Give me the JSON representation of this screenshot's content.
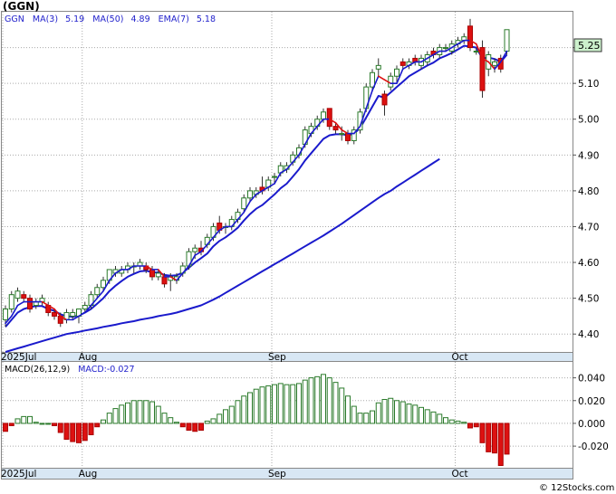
{
  "chart_data": {
    "type": "candlestick",
    "symbol": "(GGN)",
    "legend": {
      "symbol": "GGN",
      "ma3_label": "MA(3)",
      "ma3_value": "5.19",
      "ma50_label": "MA(50)",
      "ma50_value": "4.89",
      "ema7_label": "EMA(7)",
      "ema7_value": "5.18"
    },
    "last_price_label": "5.25",
    "y_ticks": [
      "5.20",
      "5.10",
      "5.00",
      "4.90",
      "4.80",
      "4.70",
      "4.60",
      "4.50",
      "4.40"
    ],
    "y_tick_values": [
      5.2,
      5.1,
      5.0,
      4.9,
      4.8,
      4.7,
      4.6,
      4.5,
      4.4
    ],
    "ylim": [
      4.35,
      5.3
    ],
    "x_labels": [
      "2025Jul",
      "Aug",
      "Sep",
      "Oct"
    ],
    "x_label_index": [
      0,
      13,
      44,
      74
    ],
    "ohlc": [
      [
        4.44,
        4.48,
        4.42,
        4.47
      ],
      [
        4.47,
        4.52,
        4.46,
        4.51
      ],
      [
        4.5,
        4.53,
        4.49,
        4.52
      ],
      [
        4.51,
        4.52,
        4.49,
        4.5
      ],
      [
        4.5,
        4.51,
        4.46,
        4.47
      ],
      [
        4.48,
        4.5,
        4.47,
        4.49
      ],
      [
        4.49,
        4.51,
        4.48,
        4.5
      ],
      [
        4.48,
        4.49,
        4.45,
        4.46
      ],
      [
        4.46,
        4.47,
        4.44,
        4.45
      ],
      [
        4.45,
        4.46,
        4.42,
        4.43
      ],
      [
        4.44,
        4.47,
        4.43,
        4.46
      ],
      [
        4.45,
        4.47,
        4.44,
        4.46
      ],
      [
        4.45,
        4.47,
        4.43,
        4.47
      ],
      [
        4.47,
        4.49,
        4.46,
        4.48
      ],
      [
        4.48,
        4.52,
        4.47,
        4.51
      ],
      [
        4.51,
        4.54,
        4.5,
        4.53
      ],
      [
        4.53,
        4.56,
        4.52,
        4.55
      ],
      [
        4.55,
        4.58,
        4.54,
        4.58
      ],
      [
        4.57,
        4.59,
        4.56,
        4.58
      ],
      [
        4.57,
        4.59,
        4.56,
        4.58
      ],
      [
        4.58,
        4.6,
        4.57,
        4.59
      ],
      [
        4.59,
        4.6,
        4.57,
        4.59
      ],
      [
        4.59,
        4.61,
        4.58,
        4.6
      ],
      [
        4.59,
        4.6,
        4.57,
        4.58
      ],
      [
        4.58,
        4.59,
        4.55,
        4.56
      ],
      [
        4.56,
        4.58,
        4.55,
        4.57
      ],
      [
        4.56,
        4.57,
        4.53,
        4.54
      ],
      [
        4.55,
        4.57,
        4.52,
        4.56
      ],
      [
        4.55,
        4.57,
        4.54,
        4.56
      ],
      [
        4.57,
        4.6,
        4.56,
        4.59
      ],
      [
        4.59,
        4.64,
        4.58,
        4.63
      ],
      [
        4.63,
        4.65,
        4.61,
        4.64
      ],
      [
        4.64,
        4.66,
        4.62,
        4.63
      ],
      [
        4.65,
        4.68,
        4.64,
        4.67
      ],
      [
        4.67,
        4.71,
        4.66,
        4.7
      ],
      [
        4.71,
        4.73,
        4.68,
        4.69
      ],
      [
        4.7,
        4.71,
        4.68,
        4.7
      ],
      [
        4.7,
        4.73,
        4.69,
        4.72
      ],
      [
        4.72,
        4.75,
        4.71,
        4.74
      ],
      [
        4.75,
        4.79,
        4.74,
        4.78
      ],
      [
        4.78,
        4.81,
        4.77,
        4.8
      ],
      [
        4.79,
        4.81,
        4.78,
        4.8
      ],
      [
        4.81,
        4.84,
        4.79,
        4.8
      ],
      [
        4.81,
        4.84,
        4.8,
        4.83
      ],
      [
        4.84,
        4.85,
        4.82,
        4.84
      ],
      [
        4.85,
        4.88,
        4.84,
        4.87
      ],
      [
        4.86,
        4.88,
        4.85,
        4.87
      ],
      [
        4.88,
        4.91,
        4.87,
        4.9
      ],
      [
        4.9,
        4.93,
        4.89,
        4.92
      ],
      [
        4.93,
        4.98,
        4.92,
        4.97
      ],
      [
        4.96,
        4.99,
        4.95,
        4.98
      ],
      [
        4.98,
        5.01,
        4.97,
        5.0
      ],
      [
        5.0,
        5.03,
        4.99,
        5.02
      ],
      [
        5.03,
        5.03,
        4.97,
        4.98
      ],
      [
        4.98,
        4.99,
        4.96,
        4.97
      ],
      [
        4.96,
        4.98,
        4.94,
        4.96
      ],
      [
        4.96,
        4.97,
        4.93,
        4.94
      ],
      [
        4.94,
        4.98,
        4.93,
        4.97
      ],
      [
        4.97,
        5.03,
        4.96,
        5.02
      ],
      [
        5.03,
        5.1,
        5.02,
        5.09
      ],
      [
        5.09,
        5.14,
        5.08,
        5.13
      ],
      [
        5.14,
        5.17,
        5.12,
        5.15
      ],
      [
        5.07,
        5.08,
        5.01,
        5.04
      ],
      [
        5.09,
        5.13,
        5.08,
        5.12
      ],
      [
        5.12,
        5.15,
        5.1,
        5.14
      ],
      [
        5.16,
        5.17,
        5.14,
        5.15
      ],
      [
        5.15,
        5.17,
        5.14,
        5.16
      ],
      [
        5.17,
        5.18,
        5.15,
        5.16
      ],
      [
        5.15,
        5.18,
        5.14,
        5.17
      ],
      [
        5.16,
        5.19,
        5.15,
        5.18
      ],
      [
        5.19,
        5.2,
        5.17,
        5.18
      ],
      [
        5.18,
        5.21,
        5.17,
        5.2
      ],
      [
        5.2,
        5.21,
        5.19,
        5.2
      ],
      [
        5.19,
        5.22,
        5.18,
        5.21
      ],
      [
        5.21,
        5.23,
        5.2,
        5.22
      ],
      [
        5.22,
        5.24,
        5.21,
        5.23
      ],
      [
        5.26,
        5.28,
        5.19,
        5.2
      ],
      [
        5.19,
        5.2,
        5.18,
        5.19
      ],
      [
        5.2,
        5.22,
        5.06,
        5.08
      ],
      [
        5.14,
        5.19,
        5.12,
        5.18
      ],
      [
        5.15,
        5.17,
        5.13,
        5.16
      ],
      [
        5.17,
        5.18,
        5.13,
        5.14
      ],
      [
        5.19,
        5.25,
        5.18,
        5.25
      ]
    ],
    "ma3": [
      4.43,
      4.45,
      4.48,
      4.49,
      4.49,
      4.49,
      4.49,
      4.48,
      4.47,
      4.45,
      4.44,
      4.44,
      4.45,
      4.46,
      4.48,
      4.5,
      4.52,
      4.55,
      4.57,
      4.58,
      4.58,
      4.59,
      4.59,
      4.59,
      4.58,
      4.58,
      4.56,
      4.56,
      4.55,
      4.57,
      4.59,
      4.62,
      4.63,
      4.65,
      4.67,
      4.69,
      4.7,
      4.7,
      4.72,
      4.74,
      4.77,
      4.79,
      4.8,
      4.81,
      4.82,
      4.85,
      4.86,
      4.88,
      4.9,
      4.93,
      4.96,
      4.98,
      5.0,
      5.0,
      4.99,
      4.97,
      4.96,
      4.96,
      4.98,
      5.03,
      5.08,
      5.12,
      5.11,
      5.1,
      5.1,
      5.14,
      5.15,
      5.16,
      5.16,
      5.17,
      5.18,
      5.19,
      5.19,
      5.2,
      5.21,
      5.22,
      5.22,
      5.21,
      5.17,
      5.16,
      5.14,
      5.16,
      5.19
    ],
    "ma50": [
      4.35,
      4.355,
      4.36,
      4.365,
      4.37,
      4.375,
      4.38,
      4.385,
      4.39,
      4.395,
      4.4,
      4.403,
      4.406,
      4.41,
      4.413,
      4.416,
      4.42,
      4.423,
      4.426,
      4.43,
      4.433,
      4.436,
      4.44,
      4.443,
      4.446,
      4.45,
      4.453,
      4.456,
      4.46,
      4.465,
      4.47,
      4.475,
      4.48,
      4.488,
      4.496,
      4.505,
      4.515,
      4.525,
      4.535,
      4.545,
      4.555,
      4.565,
      4.575,
      4.585,
      4.595,
      4.605,
      4.615,
      4.625,
      4.635,
      4.645,
      4.655,
      4.665,
      4.675,
      4.686,
      4.697,
      4.708,
      4.72,
      4.732,
      4.744,
      4.756,
      4.768,
      4.78,
      4.791,
      4.8,
      4.812,
      4.823,
      4.834,
      4.845,
      4.856,
      4.867,
      4.878,
      4.889
    ],
    "ma50_start_index": 0,
    "ema7": [
      4.42,
      4.44,
      4.46,
      4.47,
      4.475,
      4.478,
      4.478,
      4.47,
      4.465,
      4.455,
      4.45,
      4.448,
      4.452,
      4.46,
      4.47,
      4.485,
      4.5,
      4.52,
      4.535,
      4.548,
      4.56,
      4.568,
      4.575,
      4.577,
      4.572,
      4.572,
      4.565,
      4.563,
      4.564,
      4.572,
      4.585,
      4.6,
      4.612,
      4.625,
      4.645,
      4.66,
      4.67,
      4.683,
      4.697,
      4.717,
      4.735,
      4.75,
      4.76,
      4.775,
      4.79,
      4.807,
      4.82,
      4.84,
      4.86,
      4.885,
      4.905,
      4.925,
      4.945,
      4.955,
      4.958,
      4.958,
      4.955,
      4.96,
      4.975,
      5.005,
      5.035,
      5.065,
      5.06,
      5.075,
      5.09,
      5.105,
      5.12,
      5.13,
      5.14,
      5.15,
      5.158,
      5.17,
      5.177,
      5.185,
      5.195,
      5.205,
      5.203,
      5.2,
      5.17,
      5.172,
      5.168,
      5.16,
      5.18
    ],
    "macd": {
      "label": "MACD(26,12,9)",
      "value_label": "MACD:-0.027",
      "y_ticks": [
        "0.040",
        "0.020",
        "0.000",
        "-0.020"
      ],
      "y_tick_values": [
        0.04,
        0.02,
        0.0,
        -0.02
      ],
      "ylim": [
        -0.039,
        0.054
      ],
      "hist": [
        -0.007,
        -0.002,
        0.004,
        0.006,
        0.006,
        0.001,
        0,
        0,
        -0.002,
        -0.008,
        -0.014,
        -0.016,
        -0.017,
        -0.015,
        -0.01,
        -0.003,
        0.003,
        0.009,
        0.013,
        0.016,
        0.018,
        0.02,
        0.02,
        0.02,
        0.019,
        0.015,
        0.009,
        0.005,
        0.001,
        -0.003,
        -0.006,
        -0.007,
        -0.006,
        0.002,
        0.004,
        0.008,
        0.012,
        0.015,
        0.02,
        0.024,
        0.027,
        0.03,
        0.032,
        0.033,
        0.034,
        0.035,
        0.034,
        0.034,
        0.035,
        0.038,
        0.04,
        0.041,
        0.043,
        0.04,
        0.036,
        0.031,
        0.024,
        0.015,
        0.009,
        0.009,
        0.011,
        0.018,
        0.021,
        0.022,
        0.02,
        0.019,
        0.017,
        0.016,
        0.014,
        0.012,
        0.01,
        0.008,
        0.005,
        0.003,
        0.002,
        0.001,
        -0.004,
        -0.003,
        -0.017,
        -0.025,
        -0.026,
        -0.037,
        -0.027
      ]
    }
  },
  "credit": "© 12Stocks.com"
}
